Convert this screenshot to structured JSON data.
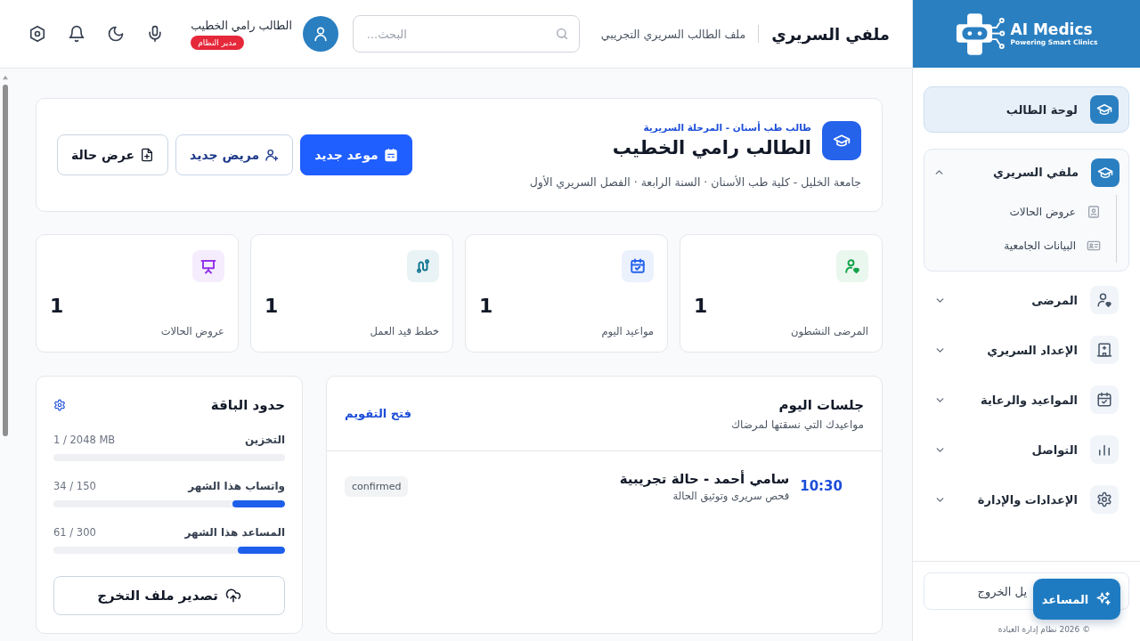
{
  "sidebar": {
    "brand": {
      "name": "AI Medics",
      "tagline": "Powering Smart Clinics"
    },
    "items": [
      {
        "label": "لوحة الطالب",
        "kind": "link",
        "selected": true
      },
      {
        "label": "ملفي السريري",
        "kind": "group",
        "selected": false,
        "expanded": true,
        "children": [
          {
            "label": "عروض الحالات",
            "selected": false
          },
          {
            "label": "البيانات الجامعية",
            "selected": false
          }
        ]
      },
      {
        "label": "المرضى",
        "kind": "group",
        "selected": false,
        "expanded": false
      },
      {
        "label": "الإعداد السريري",
        "kind": "group",
        "selected": false,
        "expanded": false
      },
      {
        "label": "المواعيد والرعاية",
        "kind": "group",
        "selected": false,
        "expanded": false
      },
      {
        "label": "التواصل",
        "kind": "group",
        "selected": false,
        "expanded": false
      },
      {
        "label": "الإعدادات والإدارة",
        "kind": "group",
        "selected": false,
        "expanded": false
      }
    ],
    "logout": "يل الخروج",
    "footer": "© 2026 نظام إدارة العيادة"
  },
  "header": {
    "title": "ملفي السريري",
    "subtitle": "ملف الطالب السريري التجريبي",
    "search": {
      "placeholder": "البحث..."
    },
    "user": {
      "name": "الطالب رامي الخطيب",
      "role": "مدير النظام"
    }
  },
  "profile": {
    "tagline": "طالب طب أسنان - المرحلة السريرية",
    "name": "الطالب رامي الخطيب",
    "details": "جامعة الخليل - كلية طب الأسنان · السنة الرابعة · الفصل السريري الأول",
    "actions": [
      {
        "label": "موعد جديد",
        "kind": "primary"
      },
      {
        "label": "مريض جديد",
        "kind": "secondary"
      },
      {
        "label": "عرض حالة",
        "kind": "plain"
      }
    ]
  },
  "stats": [
    {
      "label": "المرضى النشطون",
      "value": "1",
      "color": "#16a34a"
    },
    {
      "label": "مواعيد اليوم",
      "value": "1",
      "color": "#2563eb"
    },
    {
      "label": "خطط قيد العمل",
      "value": "1",
      "color": "#0e7490"
    },
    {
      "label": "عروض الحالات",
      "value": "1",
      "color": "#9333ea"
    }
  ],
  "sessions": {
    "title": "جلسات اليوم",
    "subtitle": "مواعيدك التي نسقتها لمرضاك",
    "link": "فتح التقويم",
    "items": [
      {
        "time": "10:30",
        "title": "سامي أحمد - حالة تجريبية",
        "note": "فحص سريرى وتوثيق الحالة",
        "status": "confirmed"
      }
    ]
  },
  "limits": {
    "title": "حدود الباقة",
    "meters": [
      {
        "label": "التخزين",
        "reading": "1 / 2048 MB",
        "level": 0.0005
      },
      {
        "label": "واتساب هذا الشهر",
        "reading": "34 / 150",
        "level": 0.227
      },
      {
        "label": "المساعد هذا الشهر",
        "reading": "61 / 300",
        "level": 0.203
      }
    ],
    "export_button": "تصدير ملف التخرج"
  },
  "assistant_button": {
    "label": "المساعد"
  }
}
